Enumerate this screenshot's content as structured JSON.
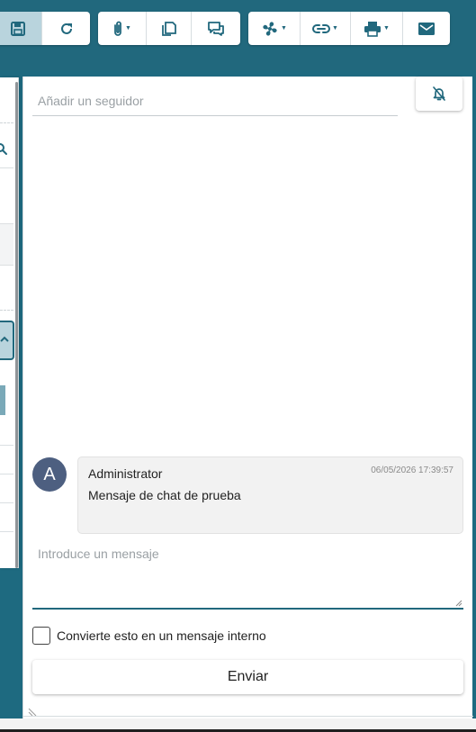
{
  "toolbar": {
    "groups": [
      {
        "buttons": [
          {
            "name": "save-icon",
            "active": true
          },
          {
            "name": "refresh-icon"
          }
        ]
      },
      {
        "buttons": [
          {
            "name": "paperclip-icon",
            "dropdown": true
          },
          {
            "name": "duplicate-icon"
          },
          {
            "name": "comments-icon"
          }
        ]
      },
      {
        "buttons": [
          {
            "name": "fan-icon",
            "dropdown": true
          },
          {
            "name": "link-icon",
            "dropdown": true
          },
          {
            "name": "printer-icon",
            "dropdown": true
          },
          {
            "name": "envelope-icon"
          }
        ]
      }
    ]
  },
  "followers": {
    "placeholder": "Añadir un seguidor",
    "bell_button_icon": "bell-slash-icon"
  },
  "chat": {
    "messages": [
      {
        "avatar_initial": "A",
        "author": "Administrator",
        "timestamp": "06/05/2026 17:39:57",
        "text": "Mensaje de chat de prueba"
      }
    ],
    "input_placeholder": "Introduce un mensaje",
    "internal_label": "Convierte esto en un mensaje interno",
    "internal_checked": false,
    "send_label": "Enviar"
  },
  "colors": {
    "header": "#21687d",
    "accent": "#21687d",
    "avatar": "#4d5f80",
    "active_button": "#b9d4dd"
  }
}
